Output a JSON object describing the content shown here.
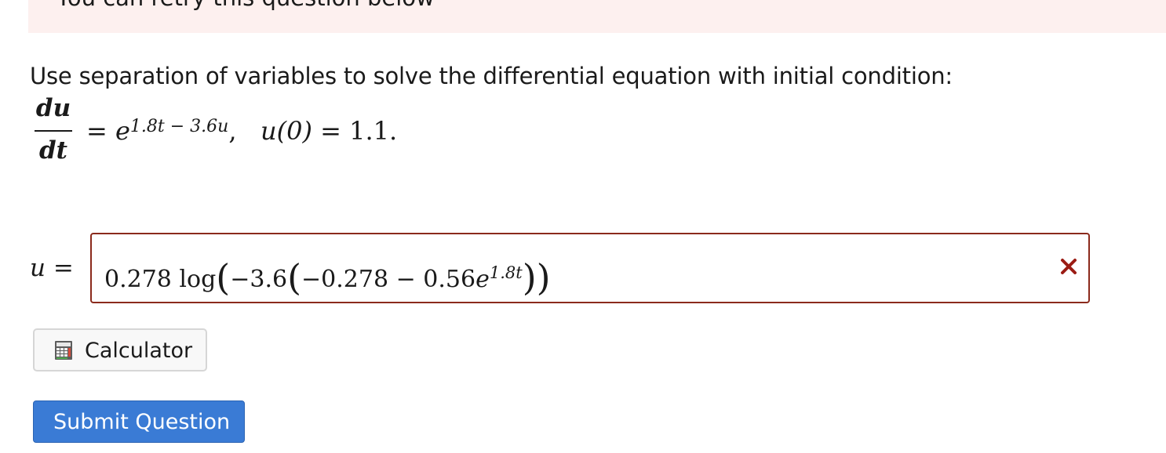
{
  "alert": {
    "text": "You can retry this question below"
  },
  "question": {
    "prompt": "Use separation of variables to solve the differential equation with initial condition:",
    "equation": {
      "numerator": "du",
      "denominator": "dt",
      "equals": "=",
      "base": "e",
      "exponent": "1.8t − 3.6u",
      "comma": ",",
      "initial_condition": "u(0)",
      "initial_equals": "=",
      "initial_value": "1.1."
    }
  },
  "answer": {
    "label": "u =",
    "coef": "0.278 log",
    "inner_1": "−3.6",
    "inner_2": "−0.278 − 0.56",
    "base": "e",
    "exponent": "1.8t",
    "status": "incorrect"
  },
  "calculator_button": {
    "label": "Calculator",
    "icon": "calculator-icon"
  },
  "submit_button": {
    "label": "Submit Question"
  },
  "colors": {
    "alert_bg": "#fdf0ef",
    "answer_border": "#8b2a1c",
    "incorrect_mark": "#9b1c14",
    "submit_bg": "#3a7bd5"
  }
}
